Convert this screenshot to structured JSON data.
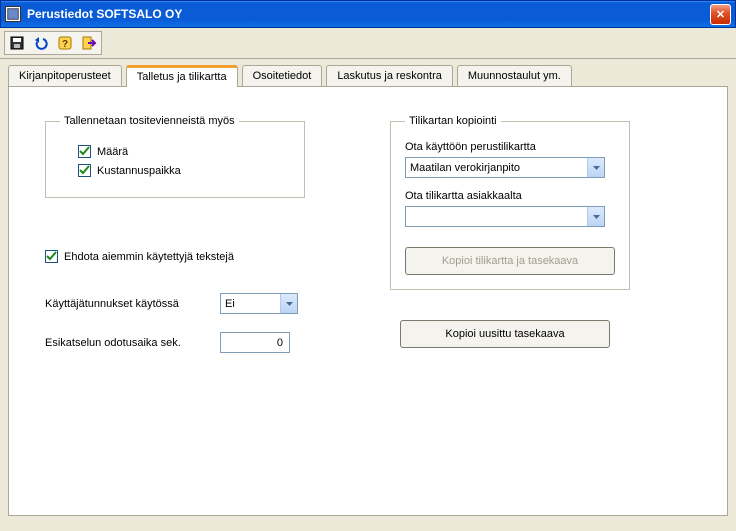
{
  "window": {
    "title": "Perustiedot   SOFTSALO OY",
    "close_glyph": "✕"
  },
  "toolbar": {
    "icons": {
      "save": "save-icon",
      "undo": "undo-icon",
      "help": "help-icon",
      "exit": "exit-icon"
    }
  },
  "tabs": {
    "kirjanpitoperusteet": "Kirjanpitoperusteet",
    "talletus": "Talletus ja tilikartta",
    "osoitetiedot": "Osoitetiedot",
    "laskutus": "Laskutus ja reskontra",
    "muunnostaulut": "Muunnostaulut ym."
  },
  "left": {
    "group_legend": "Tallennetaan tositevienneistä myös",
    "chk_maara": "Määrä",
    "chk_kustannuspaikka": "Kustannuspaikka",
    "chk_ehdota": "Ehdota aiemmin käytettyjä tekstejä",
    "kayttajat_label": "Käyttäjätunnukset käytössä",
    "kayttajat_value": "Ei",
    "esikatselu_label": "Esikatselun odotusaika  sek.",
    "esikatselu_value": "0"
  },
  "right": {
    "group_legend": "Tilikartan kopiointi",
    "ota_perus_label": "Ota käyttöön perustilikartta",
    "ota_perus_value": "Maatilan verokirjanpito",
    "ota_asiakas_label": "Ota tilikartta asiakkaalta",
    "ota_asiakas_value": "",
    "kopioi_tilikartta_btn": "Kopioi tilikartta ja tasekaava",
    "kopioi_uusittu_btn": "Kopioi uusittu tasekaava"
  }
}
